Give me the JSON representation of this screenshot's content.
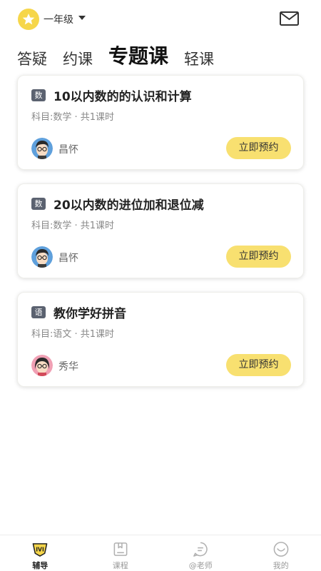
{
  "header": {
    "grade": "一年级",
    "icons": {
      "grade": "star-icon",
      "mail": "mail-icon",
      "caret": "caret-down-icon"
    }
  },
  "tabs": [
    {
      "label": "答疑",
      "active": false
    },
    {
      "label": "约课",
      "active": false
    },
    {
      "label": "专题课",
      "active": true
    },
    {
      "label": "轻课",
      "active": false
    }
  ],
  "courses": [
    {
      "subject_tag": "数",
      "title": "10以内数的的认识和计算",
      "meta": "科目:数学 · 共1课时",
      "teacher": "昌怀",
      "button": "立即预约"
    },
    {
      "subject_tag": "数",
      "title": "20以内数的进位加和退位减",
      "meta": "科目:数学 · 共1课时",
      "teacher": "昌怀",
      "button": "立即预约"
    },
    {
      "subject_tag": "语",
      "title": "教你学好拼音",
      "meta": "科目:语文 · 共1课时",
      "teacher": "秀华",
      "button": "立即预约"
    }
  ],
  "nav": [
    {
      "label": "辅导",
      "icon": "tutoring-icon",
      "active": true
    },
    {
      "label": "课程",
      "icon": "book-icon",
      "active": false
    },
    {
      "label": "@老师",
      "icon": "chat-icon",
      "active": false
    },
    {
      "label": "我的",
      "icon": "profile-icon",
      "active": false
    }
  ],
  "colors": {
    "accent": "#f6d64a",
    "button_bg": "#f8e070",
    "tag_bg": "#5b6270"
  }
}
